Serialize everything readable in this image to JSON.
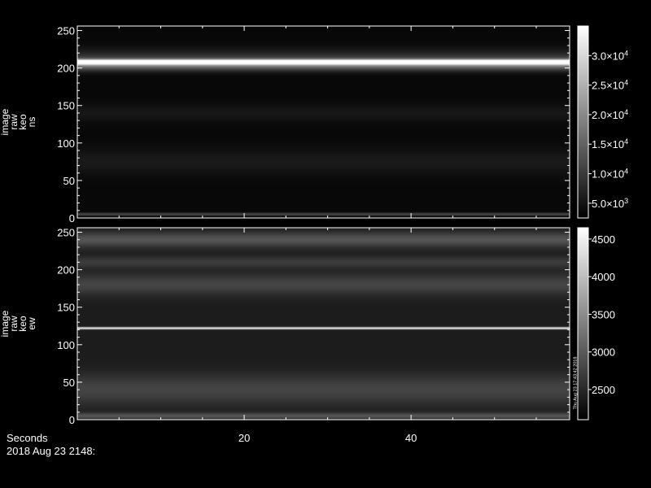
{
  "footer": {
    "xlabel": "Seconds",
    "timestamp": "2018 Aug 23 2148:"
  },
  "chart_data": [
    {
      "type": "heatmap",
      "ylabel_lines": [
        "image",
        "raw",
        "keo",
        "ns"
      ],
      "x_ticks": [
        20,
        40
      ],
      "xlim": [
        0,
        59
      ],
      "ylim": [
        0,
        256
      ],
      "y_ticks": [
        0,
        50,
        100,
        150,
        200,
        250
      ],
      "colorbar": {
        "range": [
          2500,
          35000
        ],
        "ticks": [
          {
            "value": 5000,
            "label": "5.0×10",
            "exp": "3"
          },
          {
            "value": 10000,
            "label": "1.0×10",
            "exp": "4"
          },
          {
            "value": 15000,
            "label": "1.5×10",
            "exp": "4"
          },
          {
            "value": 20000,
            "label": "2.0×10",
            "exp": "4"
          },
          {
            "value": 25000,
            "label": "2.5×10",
            "exp": "4"
          },
          {
            "value": 30000,
            "label": "3.0×10",
            "exp": "4"
          }
        ]
      },
      "bands": [
        {
          "y": 208,
          "width": 3,
          "intensity": 0.95
        },
        {
          "y": 205,
          "width": 8,
          "intensity": 0.45
        },
        {
          "y": 215,
          "width": 12,
          "intensity": 0.12
        },
        {
          "y": 140,
          "width": 12,
          "intensity": 0.06
        },
        {
          "y": 75,
          "width": 18,
          "intensity": 0.07
        },
        {
          "y": 5,
          "width": 2,
          "intensity": 0.25
        }
      ]
    },
    {
      "type": "heatmap",
      "ylabel_lines": [
        "image",
        "raw",
        "keo",
        "ew"
      ],
      "x_ticks": [
        20,
        40
      ],
      "xlim": [
        0,
        59
      ],
      "ylim": [
        0,
        256
      ],
      "y_ticks": [
        0,
        50,
        100,
        150,
        200,
        250
      ],
      "colorbar": {
        "range": [
          2100,
          4650
        ],
        "ticks": [
          {
            "value": 2500,
            "label": "2500"
          },
          {
            "value": 3000,
            "label": "3000"
          },
          {
            "value": 3500,
            "label": "3500"
          },
          {
            "value": 4000,
            "label": "4000"
          },
          {
            "value": 4500,
            "label": "4500"
          }
        ]
      },
      "colorbar_side_text": "Thu Aug 23 17:43:42 2018",
      "bands": [
        {
          "y": 122,
          "width": 1.5,
          "intensity": 0.85
        },
        {
          "y": 240,
          "width": 10,
          "intensity": 0.22
        },
        {
          "y": 210,
          "width": 8,
          "intensity": 0.12
        },
        {
          "y": 180,
          "width": 14,
          "intensity": 0.16
        },
        {
          "y": 40,
          "width": 20,
          "intensity": 0.16
        },
        {
          "y": 5,
          "width": 4,
          "intensity": 0.22
        }
      ]
    }
  ]
}
